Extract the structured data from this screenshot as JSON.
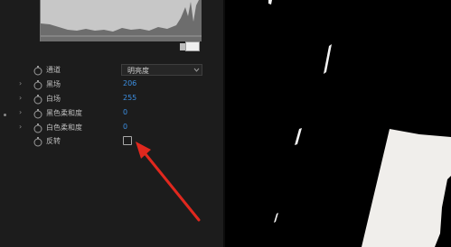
{
  "effect_controls": {
    "properties": [
      {
        "label": "通道",
        "value": "明亮度",
        "kind": "dropdown",
        "expandable": false
      },
      {
        "label": "黑场",
        "value": "206",
        "kind": "number",
        "expandable": true
      },
      {
        "label": "白场",
        "value": "255",
        "kind": "number",
        "expandable": true
      },
      {
        "label": "黑色柔和度",
        "value": "0",
        "kind": "number",
        "expandable": true
      },
      {
        "label": "白色柔和度",
        "value": "0",
        "kind": "number",
        "expandable": true
      },
      {
        "label": "反转",
        "checked": false,
        "kind": "checkbox",
        "expandable": false
      }
    ]
  },
  "icons": {
    "stopwatch": "stopwatch-icon",
    "twirl": "chevron-right-icon",
    "dropdown": "chevron-down-icon",
    "annotation": "red-arrow"
  },
  "colors": {
    "panel_bg": "#1c1c1c",
    "value_blue": "#3c8fe2",
    "label_text": "#bdbdbd",
    "annotation_red": "#e0281e",
    "viewer_bg": "#000000",
    "matte_white": "#f2f2f2"
  }
}
